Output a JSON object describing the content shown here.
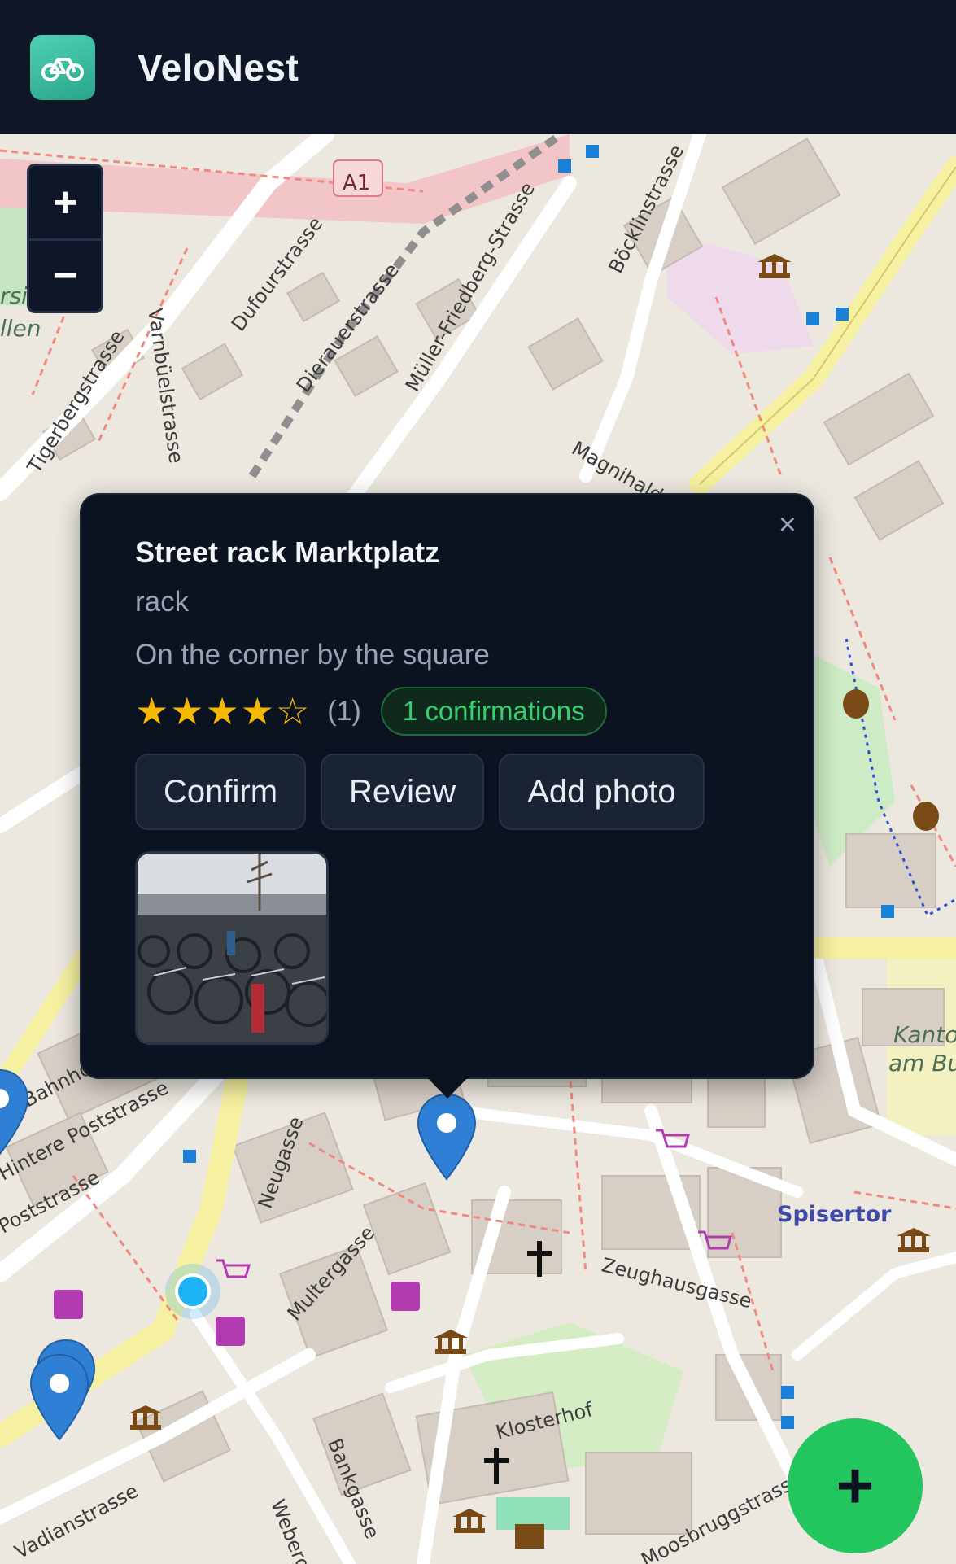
{
  "app": {
    "title": "VeloNest",
    "logo_icon": "bicycle-icon",
    "accent": "#22c55e"
  },
  "map": {
    "zoom_in_label": "+",
    "zoom_out_label": "−",
    "street_labels": [
      "Varnbüelstrasse",
      "Dufourstrasse",
      "Dierauerstrasse",
      "Müller-Friedberg-Strasse",
      "Böcklinstrasse",
      "Magnihalden",
      "Zeughausgasse",
      "Multergasse",
      "Neugasse",
      "Bankgasse",
      "Webergasse",
      "Moosbruggstrasse",
      "Vadianstrasse",
      "Poststrasse",
      "Hintere Poststrasse",
      "Bahnhofstrasse",
      "Klosterhof",
      "Spisertor",
      "Tigerbergstrasse"
    ],
    "road_shield": "A1",
    "area_labels": [
      "Kanton",
      "am Bu",
      "rsi",
      "llen"
    ]
  },
  "popup": {
    "close_label": "×",
    "title": "Street rack Marktplatz",
    "type": "rack",
    "description": "On the corner by the square",
    "rating": 4,
    "rating_max": 5,
    "rating_count": "(1)",
    "confirmations": "1 confirmations",
    "buttons": {
      "confirm": "Confirm",
      "review": "Review",
      "add_photo": "Add photo"
    }
  },
  "fab": {
    "label": "+"
  }
}
